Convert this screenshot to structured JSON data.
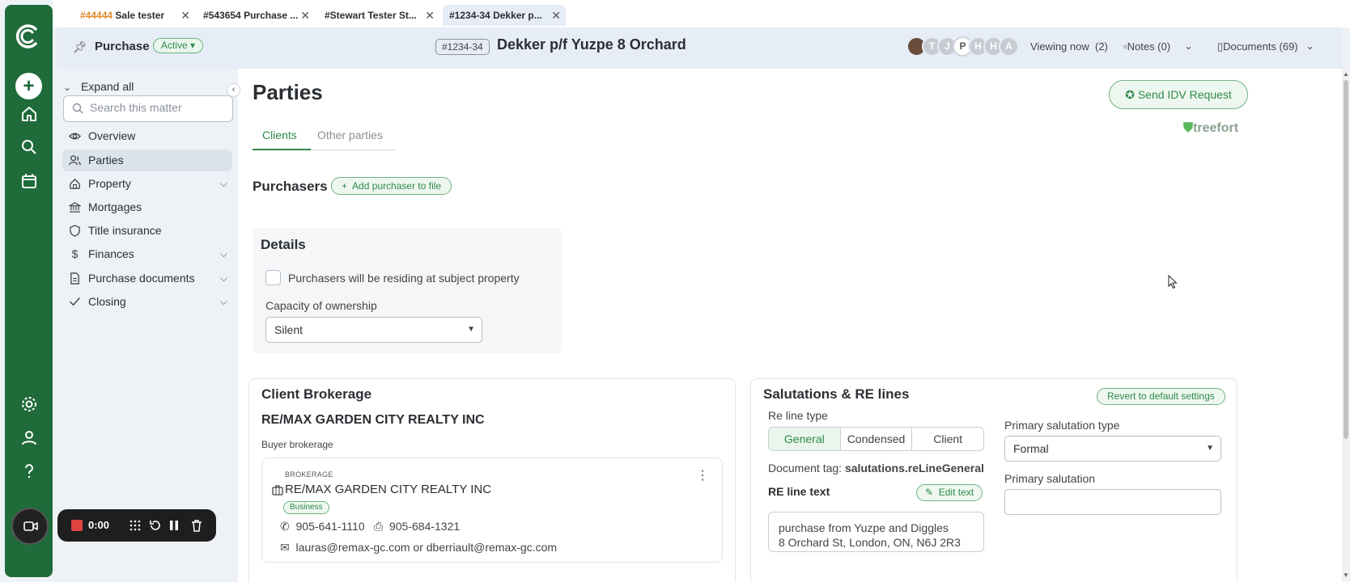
{
  "tabs": [
    {
      "num": "#44444",
      "title": "Sale tester",
      "num_color": "orange"
    },
    {
      "num": "#543654",
      "title": "Purchase ..."
    },
    {
      "num": "#Stewart Tester",
      "title": "St..."
    },
    {
      "num": "#1234-34",
      "title": "Dekker p...",
      "active": true
    }
  ],
  "header": {
    "type_label": "Purchase",
    "status": "Active",
    "matter_number": "#1234-34",
    "matter_title": "Dekker p/f Yuzpe 8 Orchard",
    "avatars": [
      "T",
      "J",
      "P",
      "H",
      "H",
      "A"
    ],
    "viewing_now": "Viewing now",
    "viewing_count": "(2)",
    "notes": "Notes (0)",
    "documents": "Documents (69)"
  },
  "sidebar": {
    "expand_all": "Expand all",
    "search_placeholder": "Search this matter",
    "items": [
      {
        "label": "Overview",
        "icon": "eye-icon"
      },
      {
        "label": "Parties",
        "icon": "users-icon",
        "active": true
      },
      {
        "label": "Property",
        "icon": "house-icon",
        "expandable": true
      },
      {
        "label": "Mortgages",
        "icon": "bank-icon"
      },
      {
        "label": "Title insurance",
        "icon": "shield-icon"
      },
      {
        "label": "Finances",
        "icon": "dollar-icon",
        "expandable": true
      },
      {
        "label": "Purchase documents",
        "icon": "document-icon",
        "expandable": true
      },
      {
        "label": "Closing",
        "icon": "check-icon",
        "expandable": true
      }
    ]
  },
  "main": {
    "title": "Parties",
    "send_idv": "Send IDV Request",
    "treefort": "treefort",
    "tabs": [
      "Clients",
      "Other parties"
    ],
    "purchasers_heading": "Purchasers",
    "add_purchaser": "Add purchaser to file",
    "details": {
      "heading": "Details",
      "checkbox_label": "Purchasers will be residing at subject property",
      "capacity_label": "Capacity of ownership",
      "capacity_value": "Silent"
    },
    "brokerage": {
      "heading": "Client Brokerage",
      "name": "RE/MAX GARDEN CITY REALTY INC",
      "role": "Buyer brokerage",
      "card_label": "BROKERAGE",
      "card_name": "RE/MAX GARDEN CITY REALTY INC",
      "badge": "Business",
      "phone": "905-641-1110",
      "fax": "905-684-1321",
      "email": "lauras@remax-gc.com or dberriault@remax-gc.com"
    },
    "salutations": {
      "heading": "Salutations & RE lines",
      "revert": "Revert to default settings",
      "re_line_type_label": "Re line type",
      "re_line_options": [
        "General",
        "Condensed",
        "Client"
      ],
      "doc_tag_label": "Document tag:",
      "doc_tag_value": "salutations.reLineGeneral",
      "re_line_text_label": "RE line text",
      "edit_text": "Edit text",
      "re_line_text_1": "purchase from Yuzpe and Diggles",
      "re_line_text_2": "8 Orchard St, London, ON, N6J 2R3",
      "primary_type_label": "Primary salutation type",
      "primary_type_value": "Formal",
      "primary_label": "Primary salutation",
      "primary_value": ""
    }
  },
  "recorder": {
    "time": "0:00"
  },
  "colors": {
    "rail": "#1f6b3a",
    "accent": "#2e8a4a",
    "tab_orange": "#e08a2b"
  }
}
